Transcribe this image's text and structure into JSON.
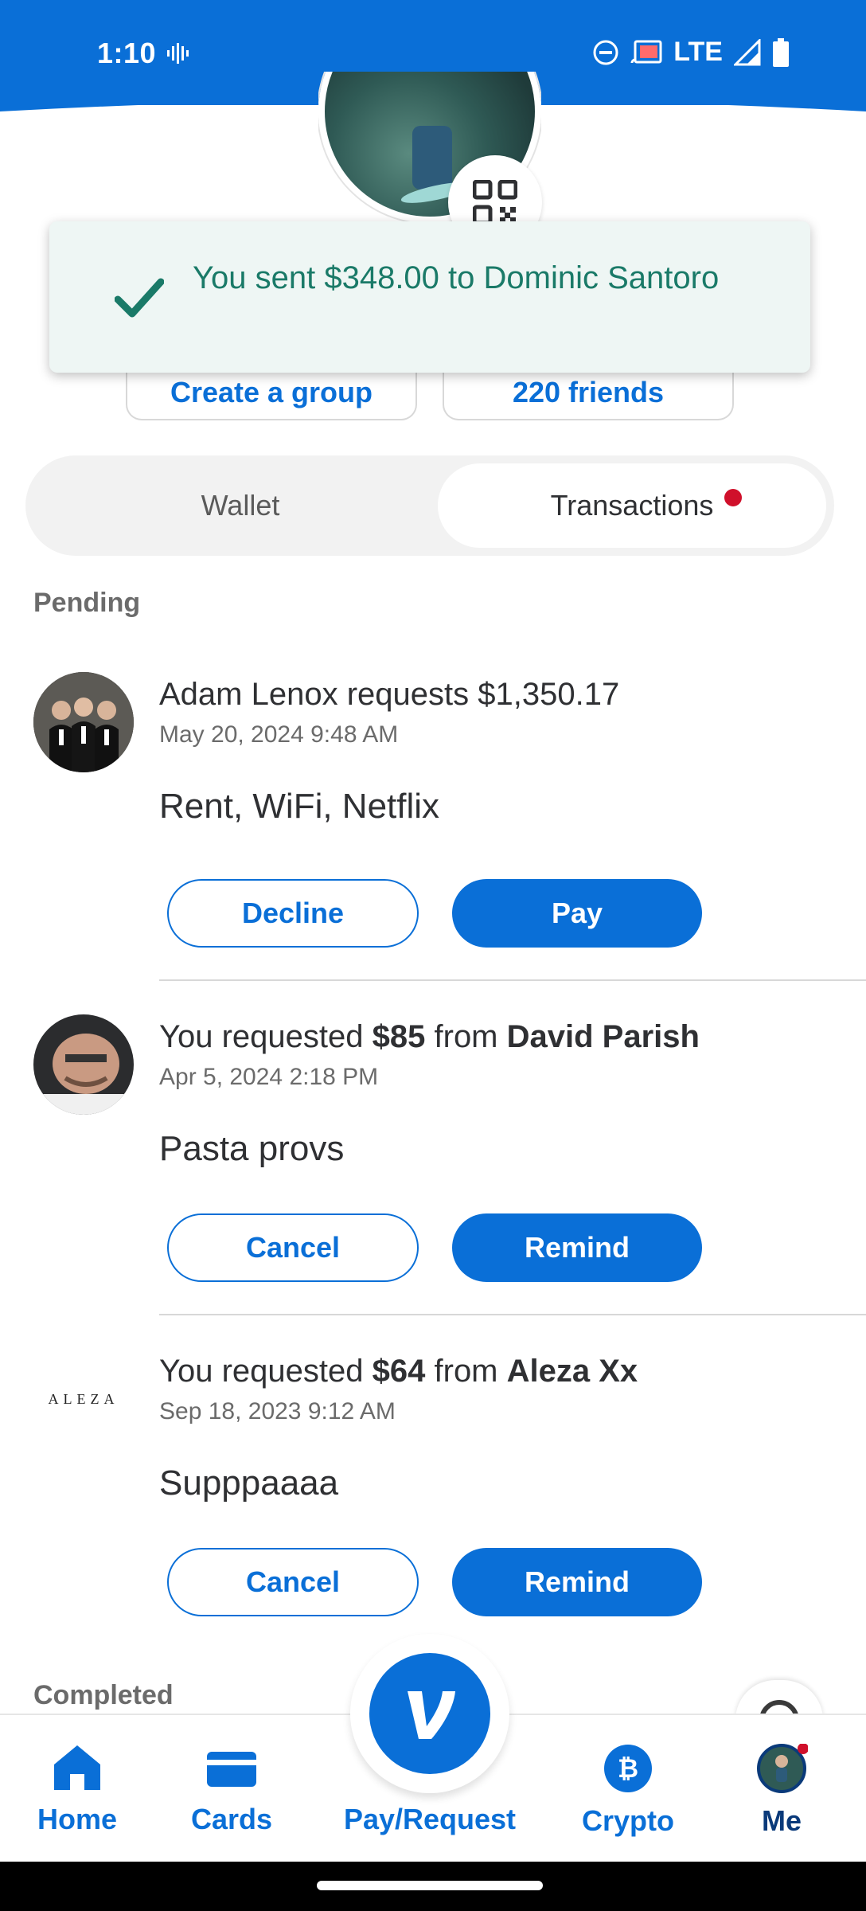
{
  "status_bar": {
    "time": "1:10",
    "network": "LTE"
  },
  "toast": {
    "message": "You sent $348.00 to Dominic Santoro"
  },
  "profile": {
    "create_group": "Create a group",
    "friends": "220 friends"
  },
  "tabs": {
    "wallet": "Wallet",
    "transactions": "Transactions"
  },
  "sections": {
    "pending": "Pending",
    "completed": "Completed"
  },
  "transactions": [
    {
      "title": "Adam Lenox requests $1,350.17",
      "date": "May 20, 2024 9:48 AM",
      "note": "Rent, WiFi, Netflix",
      "secondary": "Decline",
      "primary": "Pay"
    },
    {
      "prefix": "You requested ",
      "amount": "$85",
      "mid": " from ",
      "name": "David Parish",
      "date": "Apr 5, 2024 2:18 PM",
      "note": "Pasta provs",
      "secondary": "Cancel",
      "primary": "Remind"
    },
    {
      "prefix": "You requested ",
      "amount": "$64",
      "mid": " from ",
      "name": "Aleza Xx",
      "date": "Sep 18, 2023 9:12 AM",
      "note": "Supppaaaa",
      "secondary": "Cancel",
      "primary": "Remind",
      "logo_text": "ALEZA"
    }
  ],
  "nav": {
    "home": "Home",
    "cards": "Cards",
    "pay": "Pay/Request",
    "crypto": "Crypto",
    "me": "Me"
  },
  "colors": {
    "brand": "#0a6fd7",
    "success": "#1a7a68",
    "alert": "#d0102b"
  }
}
